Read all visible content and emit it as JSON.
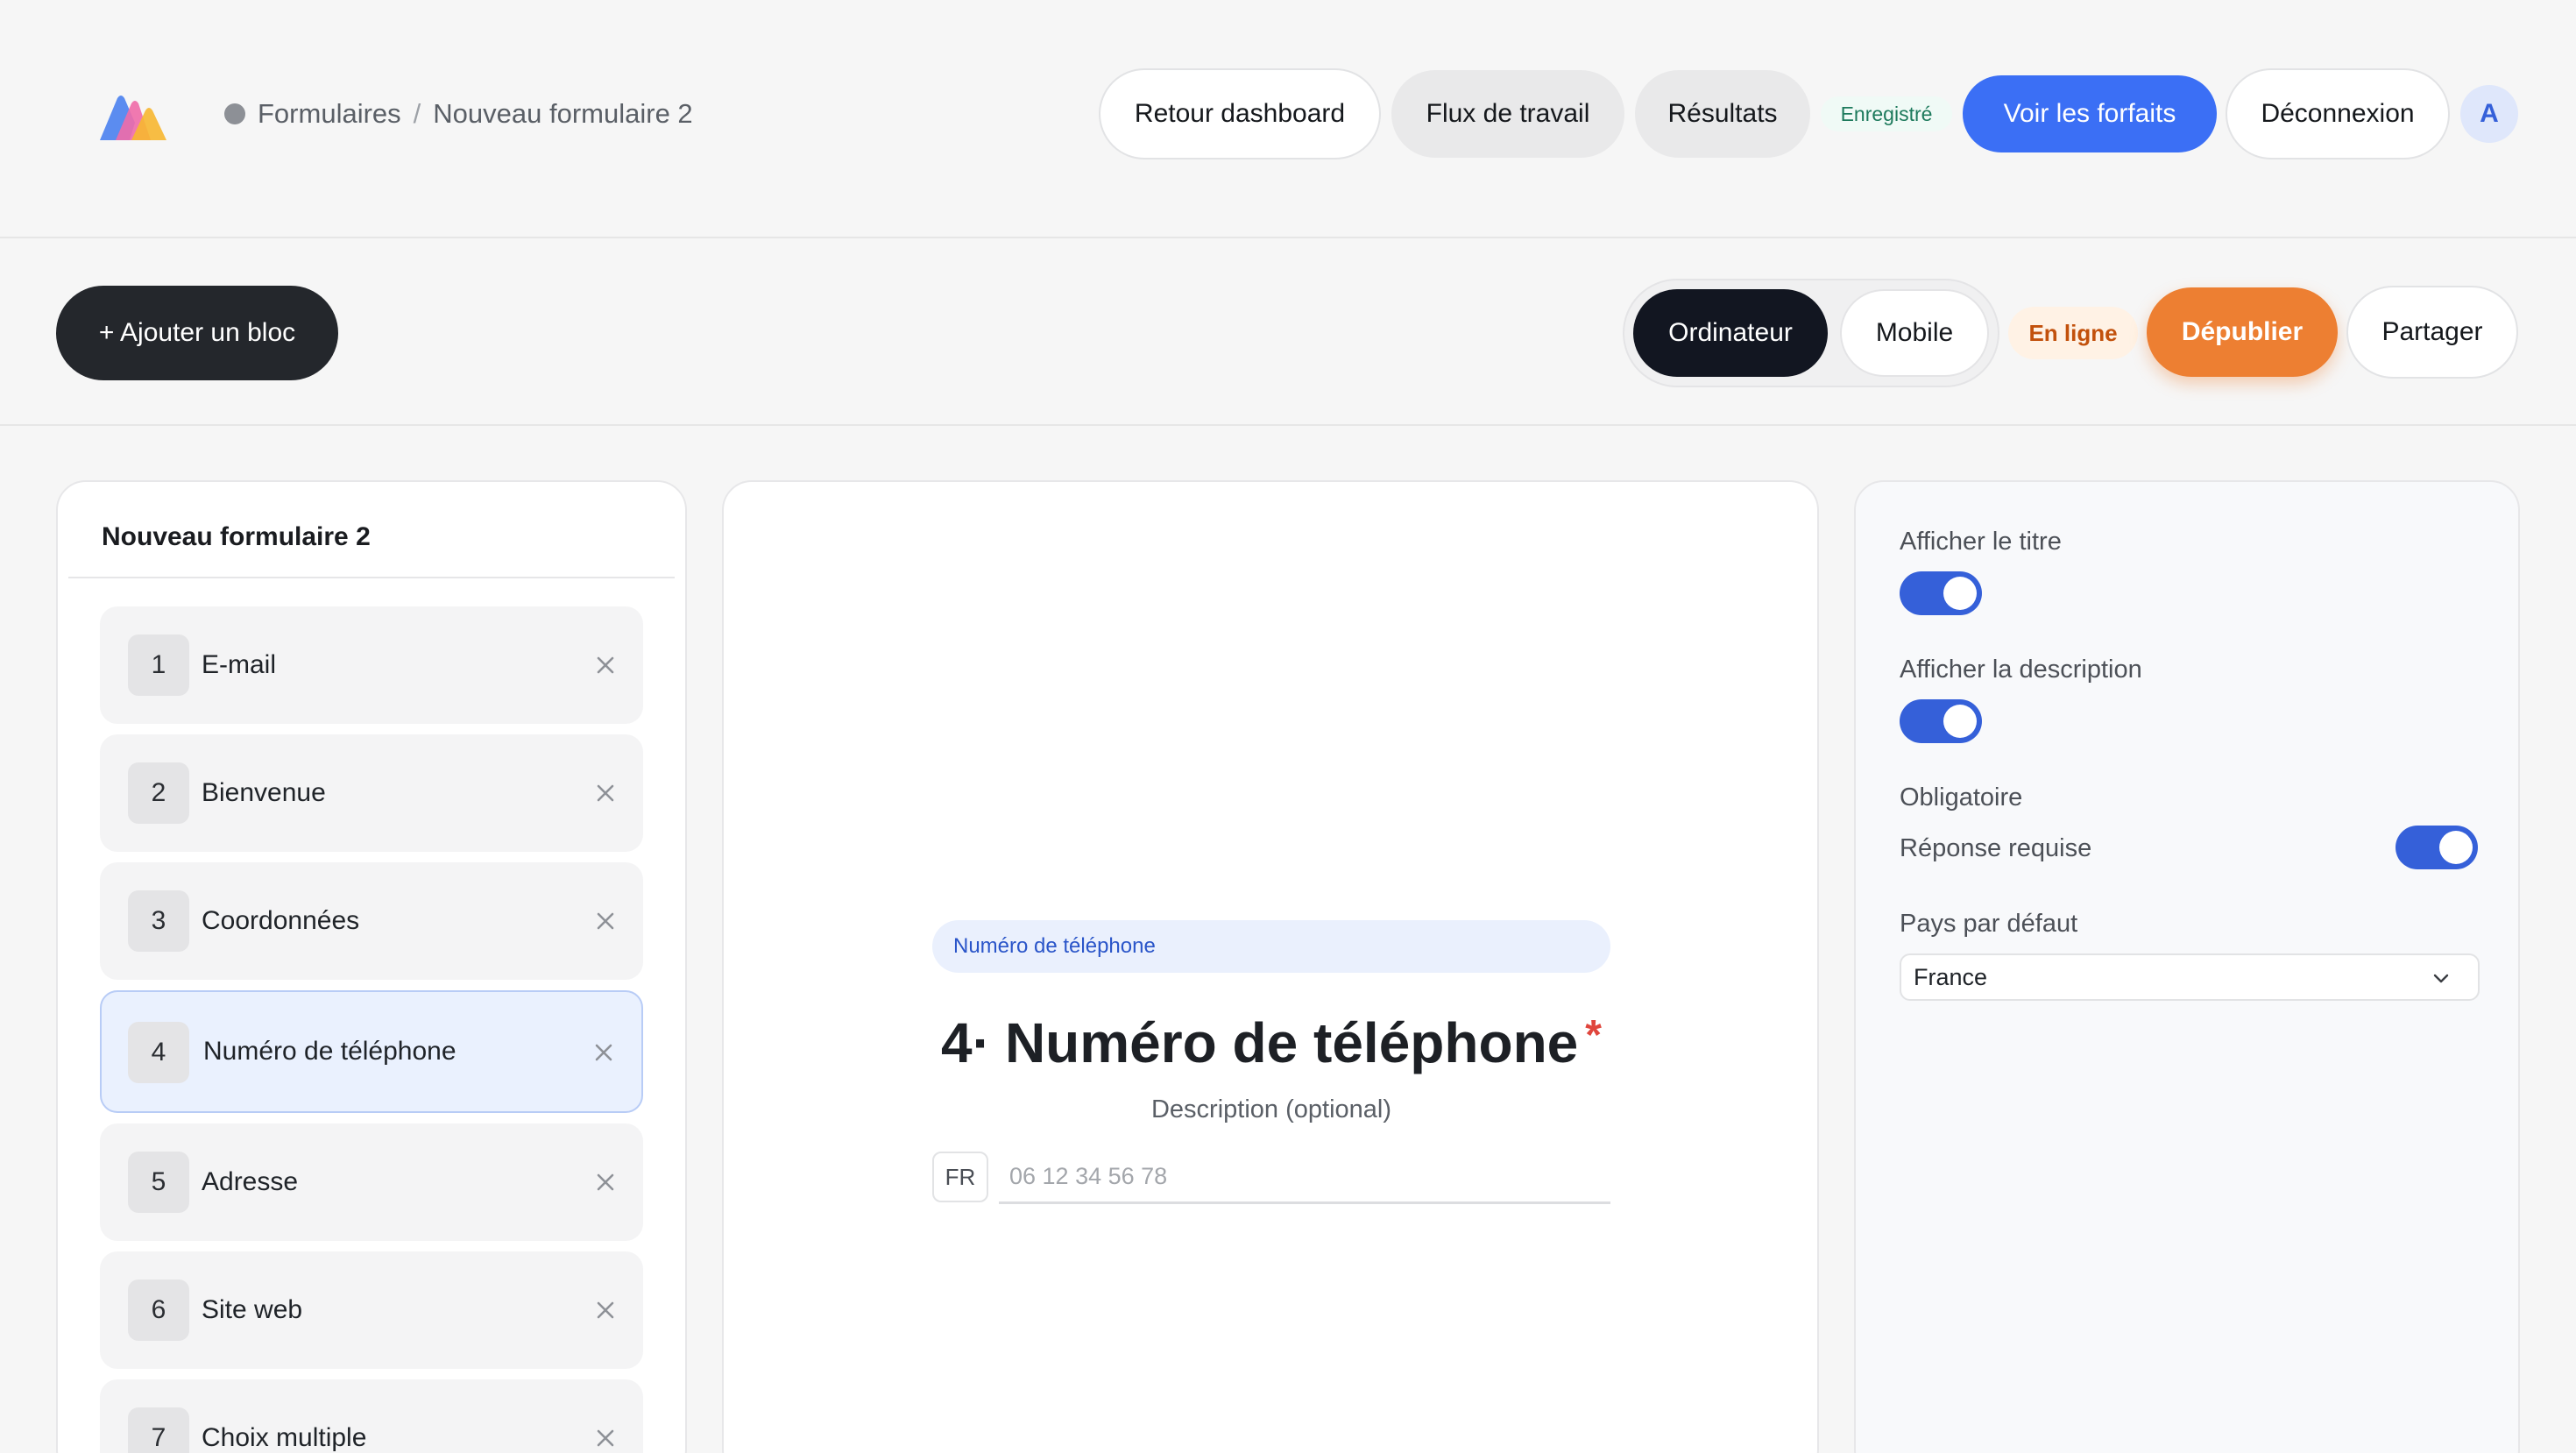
{
  "header": {
    "breadcrumb": {
      "root": "Formulaires",
      "separator": "/",
      "current": "Nouveau formulaire 2"
    },
    "buttons": {
      "back_dashboard": "Retour dashboard",
      "workflows": "Flux de travail",
      "results": "Résultats",
      "plans": "Voir les forfaits",
      "logout": "Déconnexion"
    },
    "saved_status": "Enregistré",
    "avatar_initial": "A",
    "accent_color": "#3b6ff5"
  },
  "toolbar": {
    "add_block": "+ Ajouter un bloc",
    "device_desktop": "Ordinateur",
    "device_mobile": "Mobile",
    "selected_device": "Ordinateur",
    "status_badge": "En ligne",
    "unpublish": "Dépublier",
    "share": "Partager",
    "unpublish_color": "#ed7f32"
  },
  "blocks_panel": {
    "title": "Nouveau formulaire 2",
    "active_index": 4,
    "items": [
      {
        "number": "1",
        "label": "E-mail"
      },
      {
        "number": "2",
        "label": "Bienvenue"
      },
      {
        "number": "3",
        "label": "Coordonnées"
      },
      {
        "number": "4",
        "label": "Numéro de téléphone"
      },
      {
        "number": "5",
        "label": "Adresse"
      },
      {
        "number": "6",
        "label": "Site web"
      },
      {
        "number": "7",
        "label": "Choix multiple"
      }
    ],
    "close_icon": "close-icon"
  },
  "canvas": {
    "block_type": "Numéro de téléphone",
    "question_prefix": "4·",
    "question_title": "Numéro de téléphone",
    "required_marker": "*",
    "description": "Description (optional)",
    "country_code": "FR",
    "phone_placeholder": "06 12 34 56 78"
  },
  "settings": {
    "show_title_label": "Afficher le titre",
    "show_title_on": true,
    "show_description_label": "Afficher la description",
    "show_description_on": true,
    "required_heading": "Obligatoire",
    "required_label": "Réponse requise",
    "required_on": true,
    "default_country_label": "Pays par défaut",
    "default_country_value": "France"
  }
}
